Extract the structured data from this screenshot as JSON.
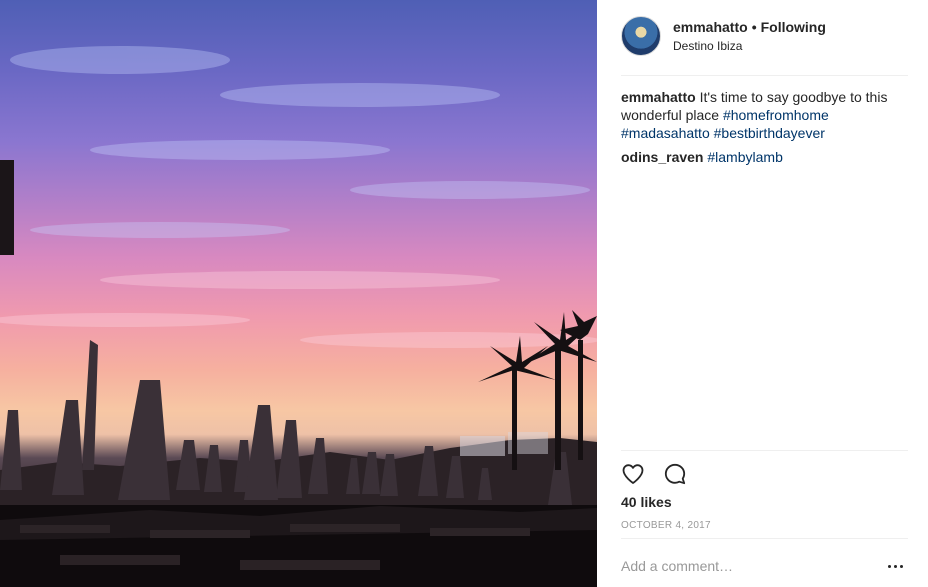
{
  "post": {
    "username": "emmahatto",
    "separator": "•",
    "follow_status": "Following",
    "location": "Destino Ibiza"
  },
  "comments": [
    {
      "user": "emmahatto",
      "text_1": "It's time to say goodbye to this wonderful place",
      "tag_1": "#homefromhome",
      "tag_2": "#madasahatto",
      "tag_3": "#bestbirthdayever"
    },
    {
      "user": "odins_raven",
      "tag_1": "#lambylamb"
    }
  ],
  "stats": {
    "likes": "40 likes",
    "date": "OCTOBER 4, 2017"
  },
  "comment_box": {
    "placeholder": "Add a comment…"
  },
  "icons": {
    "like": "heart-icon",
    "comment": "speech-bubble-icon",
    "more": "more-options-icon"
  },
  "colors": {
    "hashtag": "#003569",
    "muted": "#999999",
    "text": "#262626"
  }
}
